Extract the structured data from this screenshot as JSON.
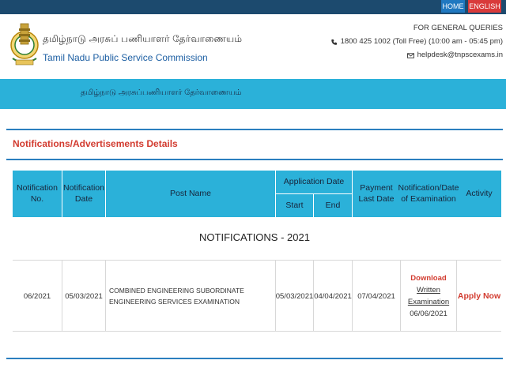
{
  "topnav": {
    "home_label": "HOME",
    "english_label": "ENGLISH"
  },
  "brand": {
    "tamil_name": "தமிழ்நாடு அரசுப் பணியாளர் தேர்வாணையம்",
    "english_name": "Tamil Nadu Public Service Commission"
  },
  "queries": {
    "heading": "FOR GENERAL QUERIES",
    "phone": "1800 425 1002 (Toll Free) (10:00 am - 05:45 pm)",
    "email": "helpdesk@tnpscexams.in"
  },
  "band": {
    "tamil_text": "தமிழ்நாடு அரசுப்பணியாளர் தேர்வாணையம்"
  },
  "panel": {
    "title": "Notifications/Advertisements Details"
  },
  "table": {
    "headers": {
      "notification_no": "Notification No.",
      "notification_date": "Notification Date",
      "post_name": "Post Name",
      "application_date": "Application Date",
      "start": "Start",
      "end": "End",
      "payment_last_date": "Payment Last Date",
      "notification_date_of_exam": "Notification/Date of Examination",
      "activity": "Activity"
    },
    "section_title": "NOTIFICATIONS - 2021",
    "rows": [
      {
        "notification_no": "06/2021",
        "notification_date": "05/03/2021",
        "post_name": "COMBINED ENGINEERING SUBORDINATE ENGINEERING SERVICES EXAMINATION",
        "start": "05/03/2021",
        "end": "04/04/2021",
        "payment_last_date": "07/04/2021",
        "download_label": "Download",
        "written_label": "Written",
        "examination_label": "Examination",
        "exam_date": "06/06/2021",
        "activity_label": "Apply Now"
      }
    ]
  },
  "colors": {
    "topbar": "#1c4a6e",
    "band": "#2bb1d9",
    "accent_red": "#d23b2f",
    "rule_blue": "#2b7fbf"
  }
}
